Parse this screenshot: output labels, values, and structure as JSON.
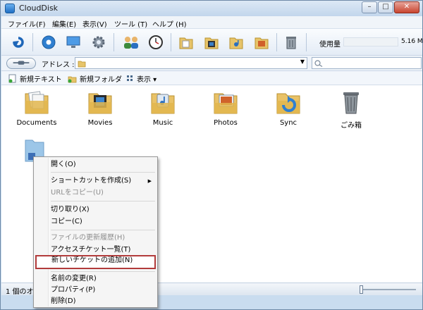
{
  "window": {
    "title": "CloudDisk"
  },
  "window_controls": {
    "minimize": "–",
    "maximize": "□",
    "close": "✕"
  },
  "menubar": [
    "ファイル(F)",
    "編集(E)",
    "表示(V)",
    "ツール (T)",
    "ヘルプ (H)"
  ],
  "toolbar": {
    "icons": [
      "refresh-icon",
      "settings-circle-icon",
      "monitor-icon",
      "gear-icon",
      "users-icon",
      "clock-icon",
      "doc-folder-icon",
      "film-folder-icon",
      "music-folder-icon",
      "photo-folder-icon",
      "trash-icon"
    ],
    "usage_label": "使用量",
    "usage_value": "5.16 M",
    "usage_fraction": 0.0
  },
  "addressbar": {
    "label": "アドレス :",
    "value": ""
  },
  "actions": {
    "new_text": "新規テキスト",
    "new_folder": "新規フォルダ",
    "view": "表示 ▾"
  },
  "files": [
    {
      "name": "Documents",
      "icon": "documents-folder-icon"
    },
    {
      "name": "Movies",
      "icon": "movies-folder-icon"
    },
    {
      "name": "Music",
      "icon": "music-folder-icon"
    },
    {
      "name": "Photos",
      "icon": "photos-folder-icon"
    },
    {
      "name": "Sync",
      "icon": "sync-folder-icon"
    },
    {
      "name": "ごみ箱",
      "icon": "recycle-bin-icon"
    }
  ],
  "status": {
    "text": "1 個のオ"
  },
  "context_menu": {
    "items": [
      {
        "label": "開く(O)",
        "disabled": false
      },
      {
        "label": "ショートカットを作成(S)",
        "disabled": false,
        "submenu": true,
        "arrow": "▶"
      },
      {
        "label": "URLをコピー(U)",
        "disabled": true
      },
      {
        "label": "切り取り(X)",
        "disabled": false
      },
      {
        "label": "コピー(C)",
        "disabled": false
      },
      {
        "label": "ファイルの更新履歴(H)",
        "disabled": true
      },
      {
        "label": "アクセスチケット一覧(T)",
        "disabled": false
      },
      {
        "label": "新しいチケットの追加(N)",
        "disabled": false,
        "highlighted": true
      },
      {
        "label": "名前の変更(R)",
        "disabled": false
      },
      {
        "label": "プロパティ(P)",
        "disabled": false
      },
      {
        "label": "削除(D)",
        "disabled": false
      }
    ]
  }
}
